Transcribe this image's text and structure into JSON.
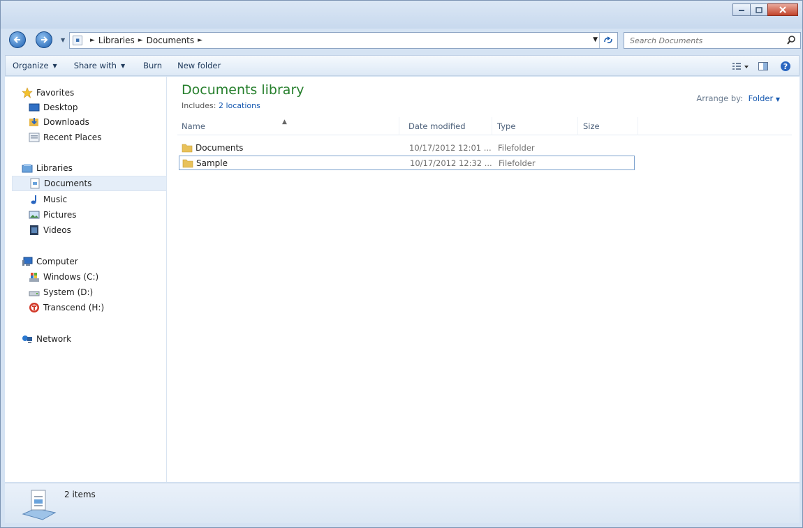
{
  "address": {
    "crumbs": [
      "Libraries",
      "Documents"
    ],
    "search_placeholder": "Search Documents"
  },
  "toolbar": {
    "organize": "Organize",
    "share_with": "Share with",
    "burn": "Burn",
    "new_folder": "New folder"
  },
  "sidebar": {
    "favorites": "Favorites",
    "desktop": "Desktop",
    "downloads": "Downloads",
    "recent_places": "Recent Places",
    "libraries": "Libraries",
    "documents": "Documents",
    "music": "Music",
    "pictures": "Pictures",
    "videos": "Videos",
    "computer": "Computer",
    "windows_c": "Windows (C:)",
    "system_d": "System (D:)",
    "transcend_h": "Transcend (H:)",
    "network": "Network"
  },
  "library": {
    "title": "Documents library",
    "includes_label": "Includes:",
    "includes_link": "2 locations",
    "arrange_label": "Arrange by:",
    "arrange_value": "Folder"
  },
  "columns": {
    "name": "Name",
    "date_modified": "Date modified",
    "type": "Type",
    "size": "Size"
  },
  "files": [
    {
      "name": "Documents",
      "date": "10/17/2012 12:01 ...",
      "type": "Filefolder"
    },
    {
      "name": "Sample",
      "date": "10/17/2012 12:32 ...",
      "type": "Filefolder"
    }
  ],
  "status": {
    "items": "2 items"
  }
}
